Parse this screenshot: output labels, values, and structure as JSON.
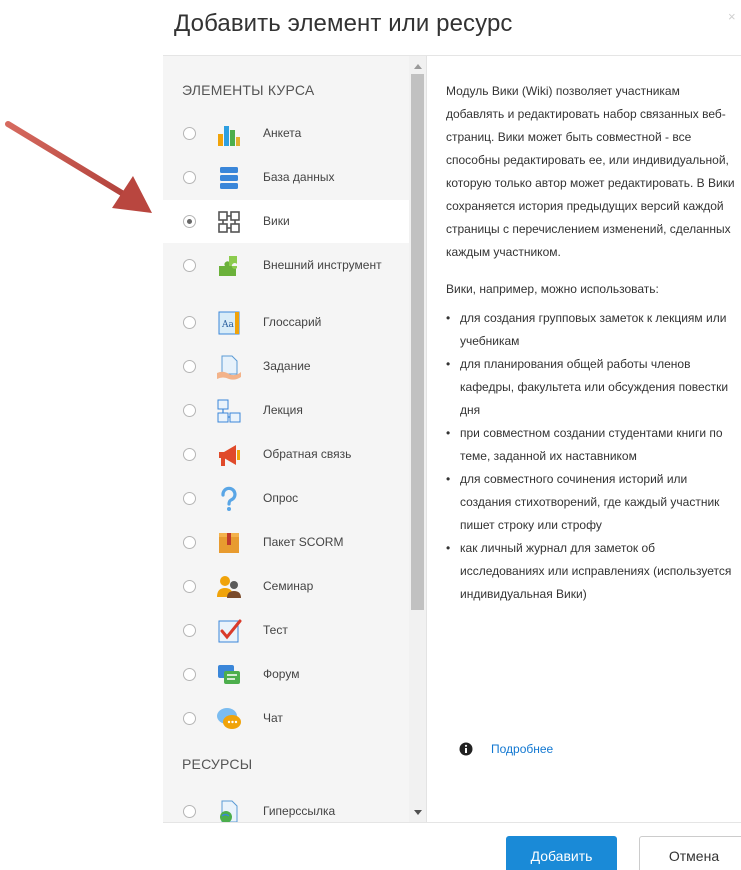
{
  "modal": {
    "title": "Добавить элемент или ресурс",
    "close": "×"
  },
  "activities": {
    "heading": "ЭЛЕМЕНТЫ КУРСА",
    "items": [
      {
        "label": "Анкета",
        "icon": "chart-bars-icon",
        "selected": false
      },
      {
        "label": "База данных",
        "icon": "database-icon",
        "selected": false
      },
      {
        "label": "Вики",
        "icon": "wiki-icon",
        "selected": true
      },
      {
        "label": "Внешний инструмент",
        "icon": "puzzle-icon",
        "selected": false
      },
      {
        "label": "Глоссарий",
        "icon": "glossary-icon",
        "selected": false
      },
      {
        "label": "Задание",
        "icon": "assignment-icon",
        "selected": false
      },
      {
        "label": "Лекция",
        "icon": "lesson-icon",
        "selected": false
      },
      {
        "label": "Обратная связь",
        "icon": "megaphone-icon",
        "selected": false
      },
      {
        "label": "Опрос",
        "icon": "question-icon",
        "selected": false
      },
      {
        "label": "Пакет SCORM",
        "icon": "scorm-package-icon",
        "selected": false
      },
      {
        "label": "Семинар",
        "icon": "workshop-icon",
        "selected": false
      },
      {
        "label": "Тест",
        "icon": "quiz-checkmark-icon",
        "selected": false
      },
      {
        "label": "Форум",
        "icon": "forum-icon",
        "selected": false
      },
      {
        "label": "Чат",
        "icon": "chat-icon",
        "selected": false
      }
    ]
  },
  "resources": {
    "heading": "РЕСУРСЫ",
    "items": [
      {
        "label": "Гиперссылка",
        "icon": "url-globe-icon",
        "selected": false
      }
    ]
  },
  "help": {
    "intro": "Модуль Вики (Wiki) позволяет участникам добавлять и редактировать набор связанных веб-страниц. Вики может быть совместной - все способны редактировать ее, или индивидуальной, которую только автор может редактировать. В Вики сохраняется история предыдущих версий каждой страницы с перечислением изменений, сделанных каждым участником.",
    "uses_heading": "Вики, например, можно использовать:",
    "uses": [
      "для создания групповых заметок к лекциям или учебникам",
      "для планирования общей работы членов кафедры, факультета или обсуждения повестки дня",
      "при совместном создании студентами книги по теме, заданной их наставником",
      "для совместного сочинения историй или создания стихотворений, где каждый участник пишет строку или строфу",
      "как личный журнал для заметок об исследованиях или исправлениях (используется индивидуальная Вики)"
    ],
    "more_link": "Подробнее"
  },
  "footer": {
    "add_label": "Добавить",
    "cancel_label": "Отмена"
  },
  "colors": {
    "primary": "#1a8ad7",
    "link": "#1177d1",
    "arrow": "#c0504d",
    "panel": "#f5f5f5"
  }
}
